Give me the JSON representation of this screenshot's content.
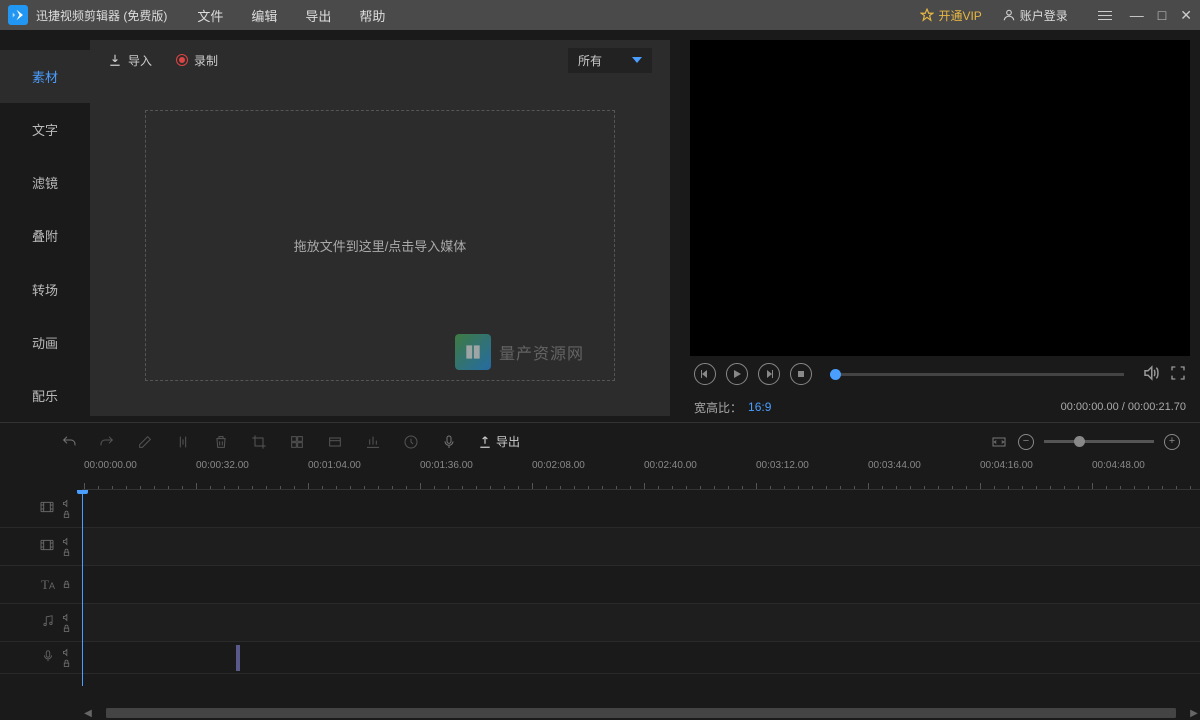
{
  "app": {
    "title": "迅捷视频剪辑器 (免费版)"
  },
  "menu": {
    "file": "文件",
    "edit": "编辑",
    "export": "导出",
    "help": "帮助"
  },
  "header": {
    "vip": "开通VIP",
    "login": "账户登录"
  },
  "leftTabs": {
    "items": [
      {
        "label": "素材",
        "active": true
      },
      {
        "label": "文字",
        "active": false
      },
      {
        "label": "滤镜",
        "active": false
      },
      {
        "label": "叠附",
        "active": false
      },
      {
        "label": "转场",
        "active": false
      },
      {
        "label": "动画",
        "active": false
      },
      {
        "label": "配乐",
        "active": false
      }
    ]
  },
  "mediaPanel": {
    "import": "导入",
    "record": "录制",
    "filter": "所有",
    "dropHint": "拖放文件到这里/点击导入媒体"
  },
  "watermark": {
    "text": "量产资源网"
  },
  "preview": {
    "aspectLabel": "宽高比：",
    "aspectValue": "16:9",
    "time": "00:00:00.00 / 00:00:21.70"
  },
  "timelineToolbar": {
    "export": "导出"
  },
  "ruler": {
    "marks": [
      "00:00:00.00",
      "00:00:32.00",
      "00:01:04.00",
      "00:01:36.00",
      "00:02:08.00",
      "00:02:40.00",
      "00:03:12.00",
      "00:03:44.00",
      "00:04:16.00",
      "00:04:48.00"
    ]
  }
}
